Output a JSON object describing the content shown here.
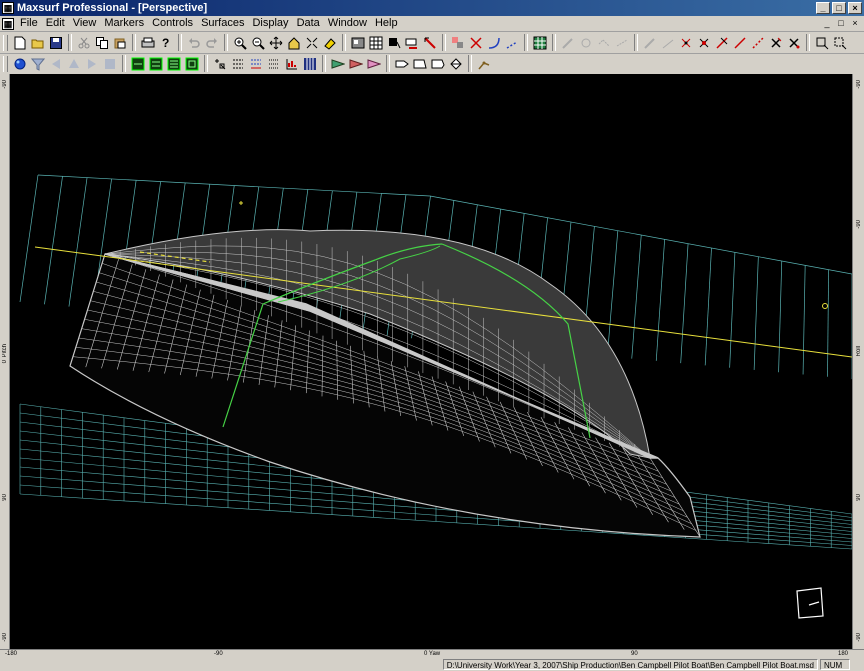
{
  "window": {
    "app_icon": "maxsurf-app-icon",
    "title": "Maxsurf Professional - [Perspective]",
    "controls": [
      "_",
      "□",
      "×"
    ]
  },
  "menu": {
    "items": [
      "File",
      "Edit",
      "View",
      "Markers",
      "Controls",
      "Surfaces",
      "Display",
      "Data",
      "Window",
      "Help"
    ],
    "doc_controls": [
      "_",
      "□",
      "×"
    ]
  },
  "toolbar1": {
    "buttons": [
      "new-file-icon",
      "open-folder-icon",
      "save-icon",
      "cut-icon",
      "copy-icon",
      "paste-icon",
      "print-icon",
      "help-cursor-icon",
      "undo-icon",
      "redo-icon",
      "zoom-in-icon",
      "zoom-out-icon",
      "pan-icon",
      "home-view-icon",
      "shrink-icon",
      "show-hide-icon",
      "render-icon",
      "surface-shade-icon",
      "marker-icon",
      "bonded-edge-icon",
      "move-icon",
      "line-icon",
      "curve-icon",
      "grid-spacing-icon",
      "pen-icon",
      "lasso-icon",
      "brush-icon",
      "ruler-icon",
      "pencil-icon",
      "point-icon",
      "add-point-icon",
      "delete-point-icon",
      "red-line-icon",
      "compact-icon",
      "bond-icon",
      "unbond-icon",
      "zoom-window-icon",
      "zoom-previous-icon"
    ]
  },
  "toolbar2": {
    "buttons": [
      "sphere-icon",
      "filter-icon",
      "view-left-icon",
      "view-up-icon",
      "view-right-icon",
      "view-down-icon",
      "body-plan-icon",
      "profile-icon",
      "plan-icon",
      "perspective-icon",
      "contours-icon",
      "net-icon",
      "curvature-icon",
      "areas-icon",
      "chart-icon",
      "table-icon",
      "surface-1-icon",
      "surface-2-icon",
      "surface-3-icon",
      "section-1-icon",
      "section-2-icon",
      "section-3-icon",
      "section-4-icon",
      "arrow-icon"
    ]
  },
  "viewport": {
    "view": "Perspective",
    "background": "#000000",
    "hull_color": "#c8c8c8",
    "grid_color": "#5ab4b4",
    "waterline_color": "#e8e03c",
    "control_curve_color": "#46d246",
    "orientation_widget": "axis-orientation-icon"
  },
  "rulers": {
    "left": [
      "-90",
      "Pitch",
      "0",
      "90",
      "-90"
    ],
    "right": [
      "-90",
      "Roll",
      "0",
      "90",
      "-90"
    ],
    "bottom": [
      "-180",
      "-90",
      "0 Yaw",
      "90",
      "180"
    ]
  },
  "status": {
    "path": "D:\\University Work\\Year 3, 2007\\Ship Production\\Ben Campbell Pilot Boat\\Ben Campbell Pilot Boat.msd",
    "num": "NUM"
  }
}
